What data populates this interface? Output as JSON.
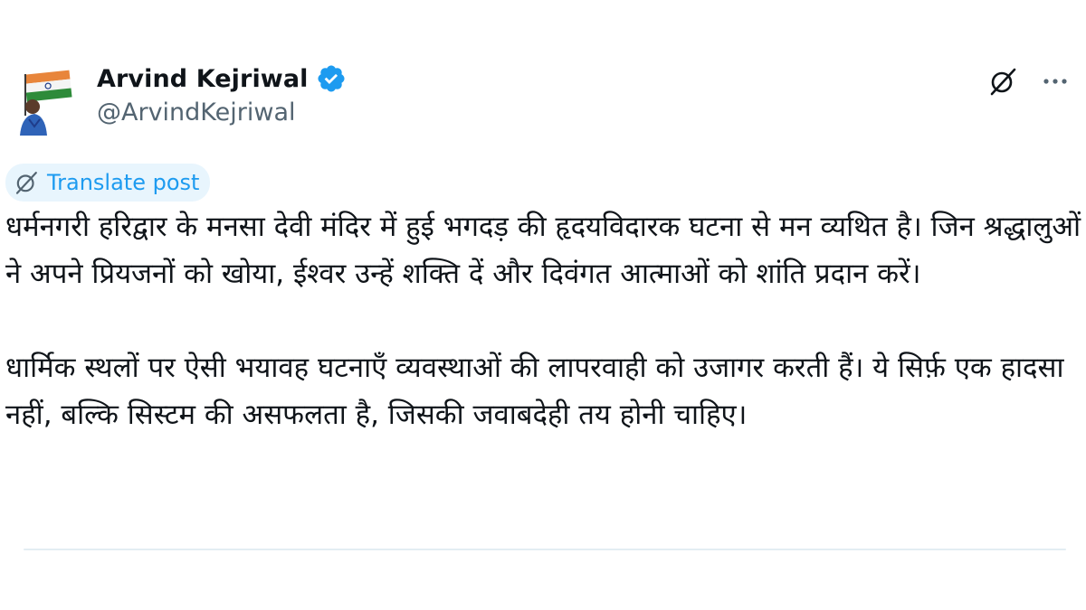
{
  "author": {
    "name": "Arvind Kejriwal",
    "handle": "@ArvindKejriwal",
    "verified": true,
    "avatar_icon": "profile-photo-with-flag"
  },
  "header_actions": {
    "grok_icon": "grok-icon",
    "more_icon": "more-options-icon",
    "more_label": "···"
  },
  "translate": {
    "label": "Translate post",
    "icon": "grok-icon"
  },
  "post": {
    "paragraphs": [
      "धर्मनगरी हरिद्वार के मनसा देवी मंदिर में हुई भगदड़ की हृदयविदारक घटना से मन व्यथित है। जिन श्रद्धालुओं ने अपने प्रियजनों को खोया, ईश्वर उन्हें शक्ति दें और दिवंगत आत्माओं को शांति प्रदान करें।",
      "धार्मिक स्थलों पर ऐसी भयावह घटनाएँ व्यवस्थाओं की लापरवाही को उजागर करती हैं। ये सिर्फ़ एक हादसा नहीं, बल्कि सिस्टम की असफलता है, जिसकी जवाबदेही तय होनी चाहिए।"
    ]
  },
  "colors": {
    "accent": "#1d9bf0",
    "text": "#0f1419",
    "secondary": "#536471",
    "translate_bg": "#e8f5fd"
  }
}
